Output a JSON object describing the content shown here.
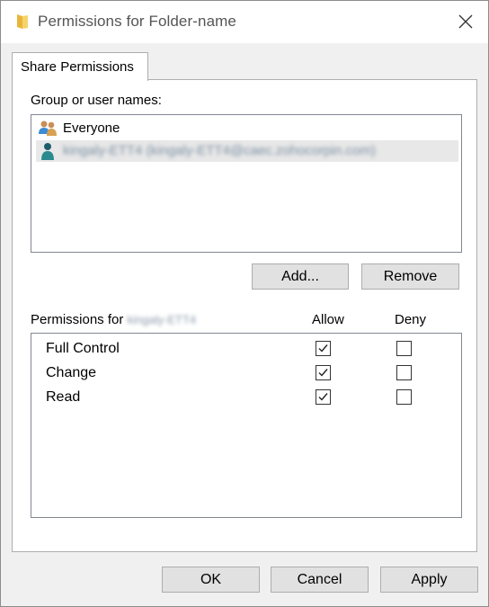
{
  "window": {
    "title": "Permissions for Folder-name",
    "tab": "Share Permissions"
  },
  "users": {
    "label": "Group or user names:",
    "items": [
      {
        "name": "Everyone",
        "icon": "users-group-icon",
        "selected": false
      },
      {
        "name": "kingaly-ETT4 (kingaly-ETT4@caec.zohocorpin.com)",
        "icon": "user-icon",
        "selected": true,
        "blurred": true
      }
    ],
    "add_label": "Add...",
    "remove_label": "Remove"
  },
  "permissions": {
    "label_prefix": "Permissions for",
    "label_user": "kingaly-ETT4",
    "allow_header": "Allow",
    "deny_header": "Deny",
    "rows": [
      {
        "name": "Full Control",
        "allow": true,
        "deny": false
      },
      {
        "name": "Change",
        "allow": true,
        "deny": false
      },
      {
        "name": "Read",
        "allow": true,
        "deny": false
      }
    ]
  },
  "buttons": {
    "ok": "OK",
    "cancel": "Cancel",
    "apply": "Apply"
  }
}
